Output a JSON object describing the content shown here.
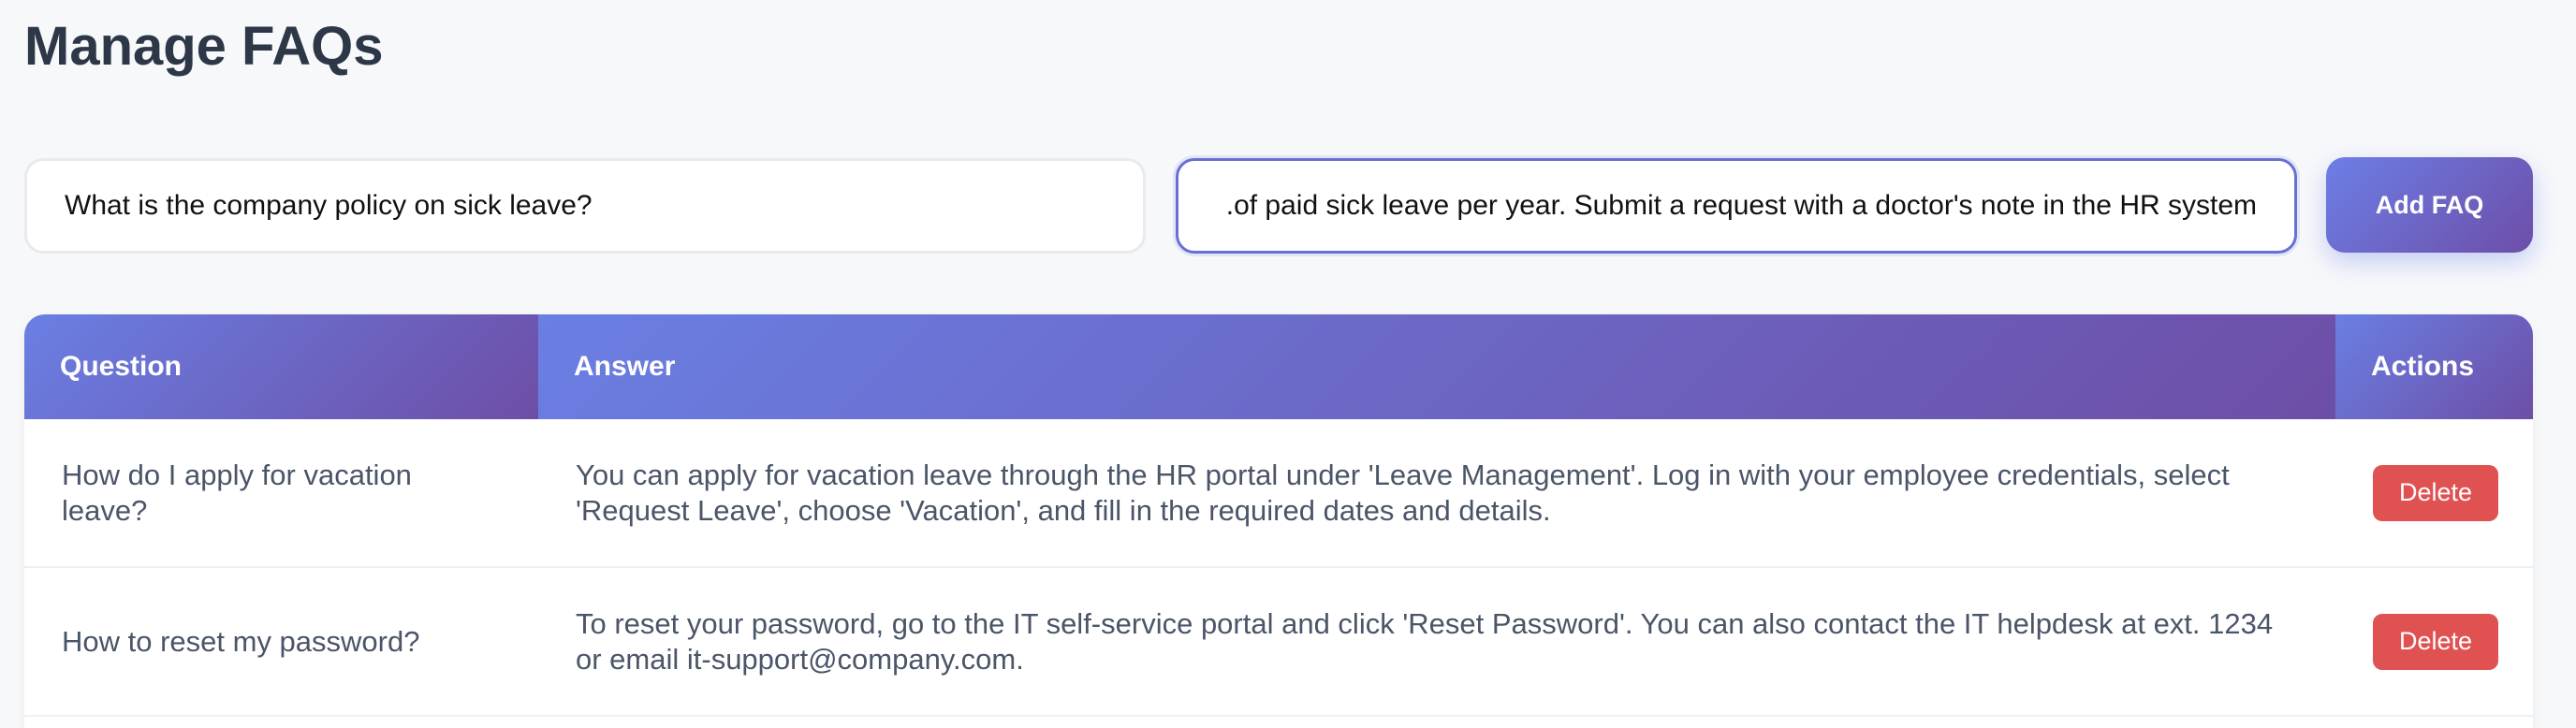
{
  "page": {
    "title": "Manage FAQs"
  },
  "form": {
    "question_value": "What is the company policy on sick leave?",
    "answer_value": "of paid sick leave per year. Submit a request with a doctor's note in the HR system.",
    "add_label": "Add FAQ"
  },
  "table": {
    "headers": {
      "question": "Question",
      "answer": "Answer",
      "actions": "Actions"
    },
    "rows": [
      {
        "question": "How do I apply for vacation leave?",
        "answer": "You can apply for vacation leave through the HR portal under 'Leave Management'. Log in with your employee credentials, select 'Request Leave', choose 'Vacation', and fill in the required dates and details.",
        "action_label": "Delete"
      },
      {
        "question": "How to reset my password?",
        "answer": "To reset your password, go to the IT self-service portal and click 'Reset Password'. You can also contact the IT helpdesk at ext. 1234 or email it-support@company.com.",
        "action_label": "Delete"
      }
    ]
  },
  "colors": {
    "accent_start": "#667eea",
    "accent_end": "#764ba2",
    "danger": "#e05252",
    "title": "#2d3748"
  }
}
